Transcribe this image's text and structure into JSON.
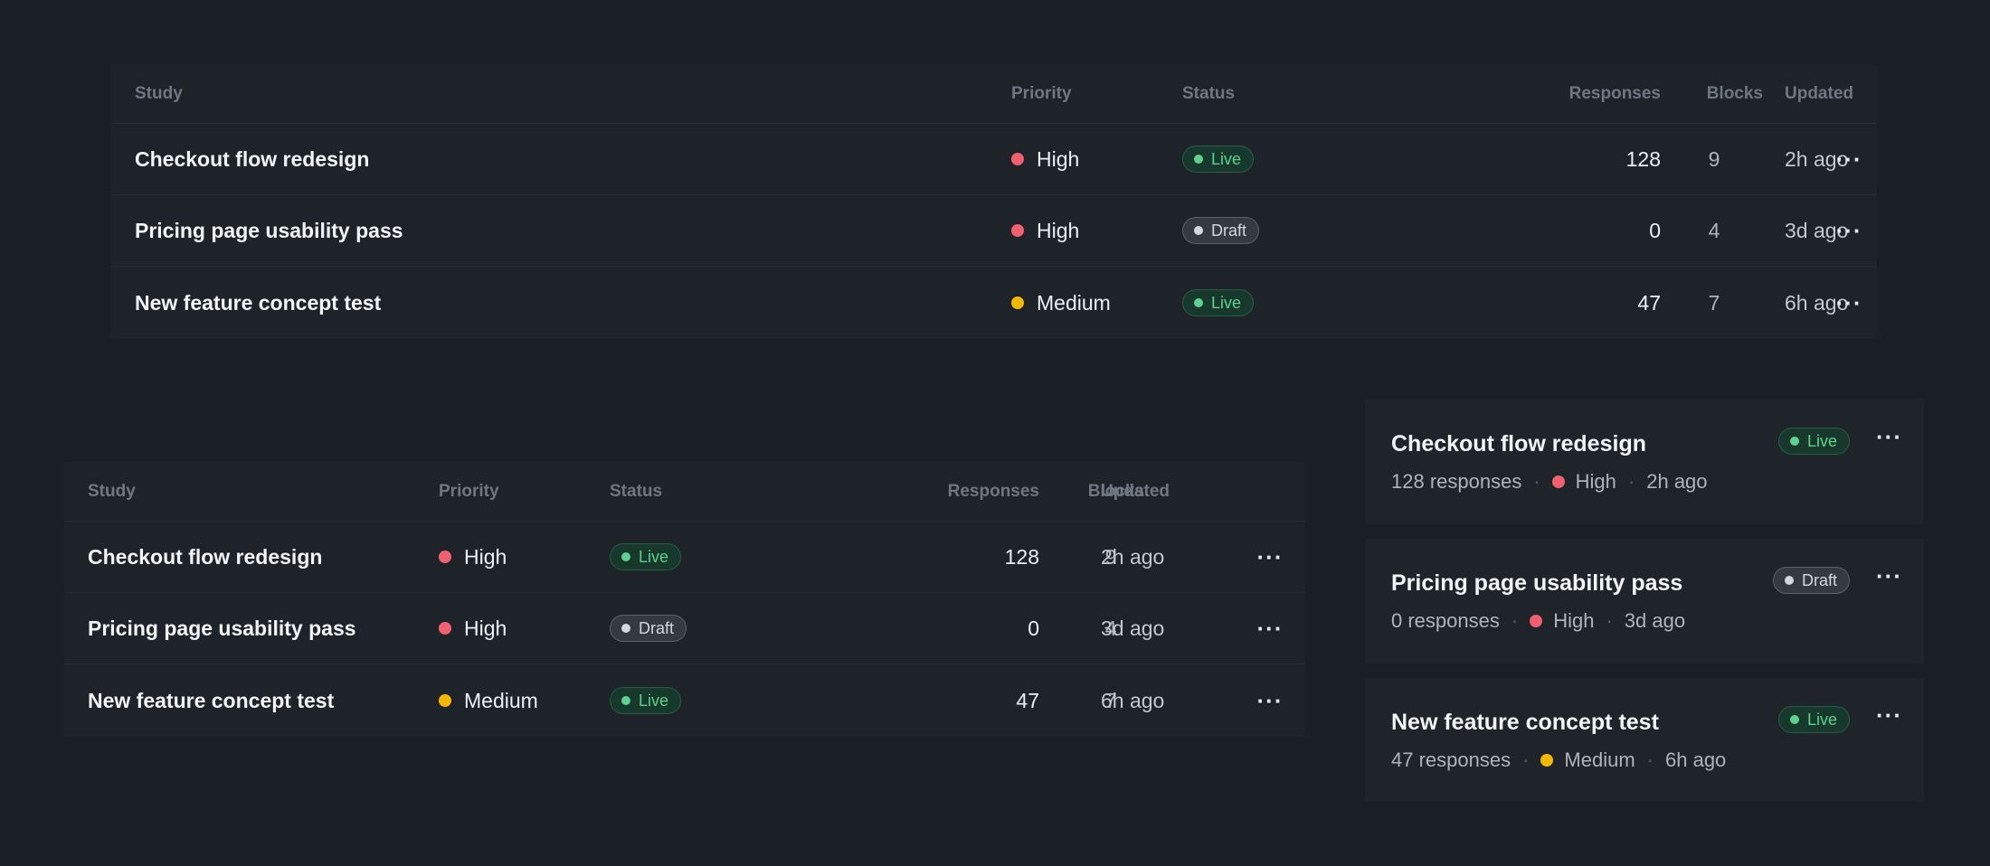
{
  "colors": {
    "high": "#f0606e",
    "medium": "#f5b800"
  },
  "table": {
    "headers": {
      "study": "Study",
      "priority": "Priority",
      "status": "Status",
      "responses": "Responses",
      "blocks": "Blocks",
      "updated": "Updated"
    },
    "more_label": "···",
    "rows": [
      {
        "study": "Checkout flow redesign",
        "priority": "High",
        "status": "Live",
        "responses": "128",
        "blocks": "9",
        "updated": "2h ago"
      },
      {
        "study": "Pricing page usability pass",
        "priority": "High",
        "status": "Draft",
        "responses": "0",
        "blocks": "4",
        "updated": "3d ago"
      },
      {
        "study": "New feature concept test",
        "priority": "Medium",
        "status": "Live",
        "responses": "47",
        "blocks": "7",
        "updated": "6h ago"
      }
    ]
  },
  "cards": [
    {
      "title": "Checkout flow redesign",
      "responses": "128 responses",
      "priority": "High",
      "status": "Live",
      "updated": "2h ago"
    },
    {
      "title": "Pricing page usability pass",
      "responses": "0 responses",
      "priority": "High",
      "status": "Draft",
      "updated": "3d ago"
    },
    {
      "title": "New feature concept test",
      "responses": "47 responses",
      "priority": "Medium",
      "status": "Live",
      "updated": "6h ago"
    }
  ],
  "separator": "·"
}
